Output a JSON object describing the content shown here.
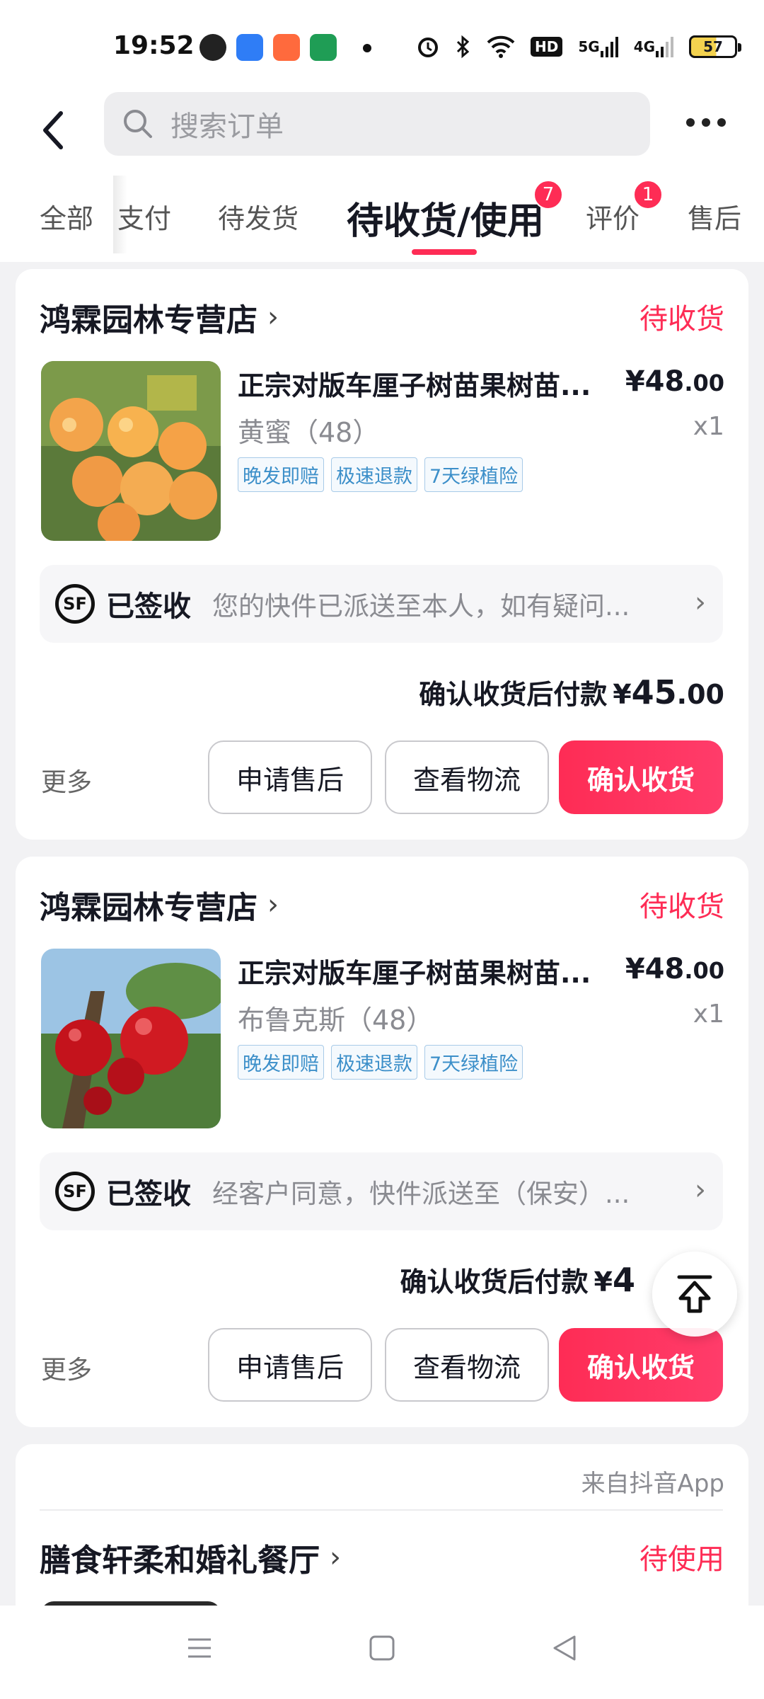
{
  "status_bar": {
    "time": "19:52",
    "battery": "57",
    "net1": "5G",
    "net2": "4G",
    "hd": "HD"
  },
  "header": {
    "search_placeholder": "搜索订单"
  },
  "tabs": [
    {
      "label": "全部"
    },
    {
      "label": "支付"
    },
    {
      "label": "待发货"
    },
    {
      "label": "待收货/使用",
      "badge": "7"
    },
    {
      "label": "评价",
      "badge": "1"
    },
    {
      "label": "售后"
    }
  ],
  "orders": [
    {
      "shop": "鸿霖园林专营店",
      "status": "待收货",
      "title": "正宗对版车厘子树苗果树苗...",
      "price_int": "¥48",
      "price_dec": ".00",
      "variant": "黄蜜（48）",
      "qty": "x1",
      "tags": [
        "晚发即赔",
        "极速退款",
        "7天绿植险"
      ],
      "logistics_status": "已签收",
      "logistics_text": "您的快件已派送至本人，如有疑问...",
      "pay_label": "确认收货后付款",
      "pay_int": "45",
      "pay_dec": ".00",
      "more": "更多",
      "btn_after_sale": "申请售后",
      "btn_logistics": "查看物流",
      "btn_confirm": "确认收货"
    },
    {
      "shop": "鸿霖园林专营店",
      "status": "待收货",
      "title": "正宗对版车厘子树苗果树苗...",
      "price_int": "¥48",
      "price_dec": ".00",
      "variant": "布鲁克斯（48）",
      "qty": "x1",
      "tags": [
        "晚发即赔",
        "极速退款",
        "7天绿植险"
      ],
      "logistics_status": "已签收",
      "logistics_text": "经客户同意，快件派送至（保安）...",
      "pay_label": "确认收货后付款",
      "pay_int": "4",
      "pay_dec": "",
      "more": "更多",
      "btn_after_sale": "申请售后",
      "btn_logistics": "查看物流",
      "btn_confirm": "确认收货"
    },
    {
      "source": "来自抖音App",
      "shop": "膳食轩柔和婚礼餐厅",
      "status": "待使用"
    }
  ],
  "colors": {
    "accent": "#fe2c55",
    "tag_blue": "#3c8fc9",
    "background": "#f2f2f4"
  }
}
